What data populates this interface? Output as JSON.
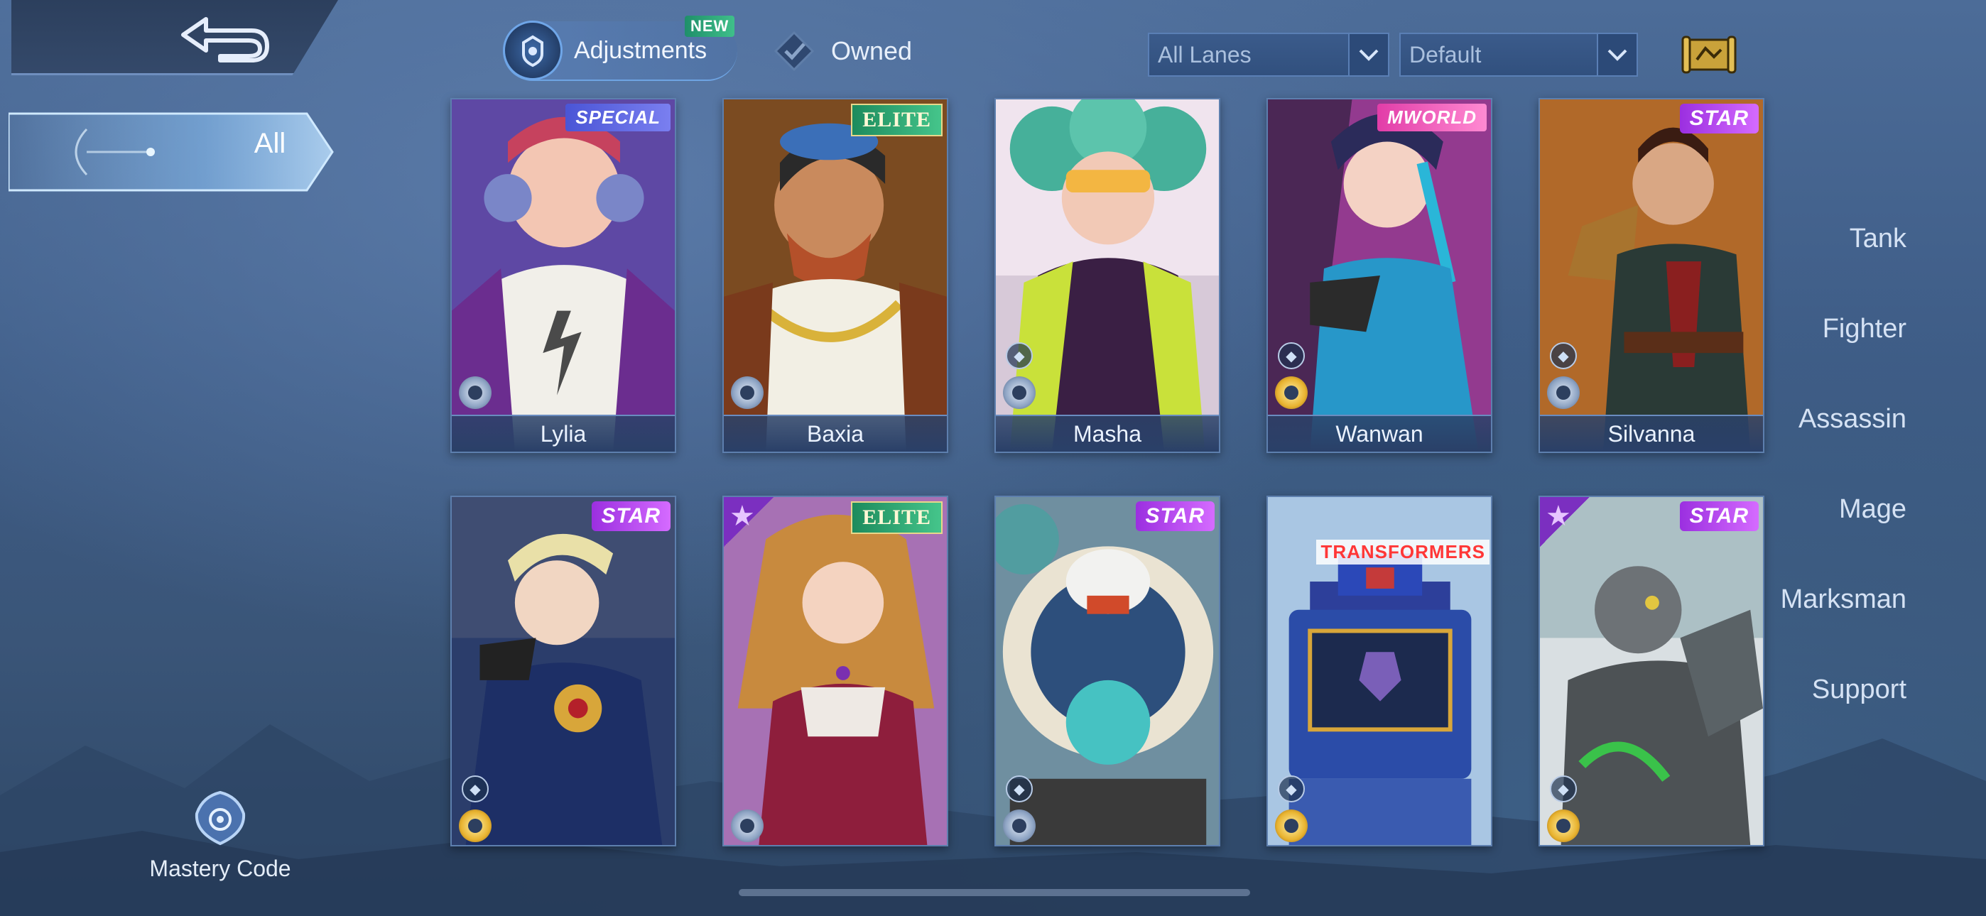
{
  "header": {
    "back_icon": "back-arrow-icon",
    "tabs": [
      {
        "label": "Adjustments",
        "badge": "NEW",
        "icon": "adjustments-helmet-icon",
        "active": true
      },
      {
        "label": "Owned",
        "icon": "diamond-check-icon",
        "active": false
      }
    ],
    "filters": {
      "lane": "All Lanes",
      "sort": "Default"
    },
    "map_icon": "scroll-map-icon"
  },
  "sidebar": {
    "items": [
      {
        "label": "All",
        "active": true
      },
      {
        "label": "Tank"
      },
      {
        "label": "Fighter"
      },
      {
        "label": "Assassin"
      },
      {
        "label": "Mage"
      },
      {
        "label": "Marksman"
      },
      {
        "label": "Support"
      }
    ],
    "mastery": {
      "label": "Mastery Code",
      "icon": "mastery-emblem-icon"
    }
  },
  "heroes": [
    {
      "name": "Lylia",
      "tag": "SPECIAL",
      "emblem": "silver"
    },
    {
      "name": "Baxia",
      "tag": "ELITE",
      "emblem": "silver"
    },
    {
      "name": "Masha",
      "tag": "",
      "emblem": "silver"
    },
    {
      "name": "Wanwan",
      "tag": "MWORLD",
      "emblem": "gold"
    },
    {
      "name": "Silvanna",
      "tag": "STAR",
      "emblem": "silver"
    },
    {
      "name": "",
      "tag": "STAR",
      "emblem": "gold"
    },
    {
      "name": "",
      "tag": "ELITE",
      "emblem": "silver"
    },
    {
      "name": "",
      "tag": "STAR",
      "emblem": "silver"
    },
    {
      "name": "",
      "tag": "TRANSFORMERS",
      "emblem": "gold"
    },
    {
      "name": "",
      "tag": "STAR",
      "emblem": "gold"
    }
  ],
  "colors": {
    "accent": "#6fa6e8",
    "star_tag": "#b14cf0",
    "elite_tag": "#2fa873",
    "special_tag": "#5a63e0"
  }
}
